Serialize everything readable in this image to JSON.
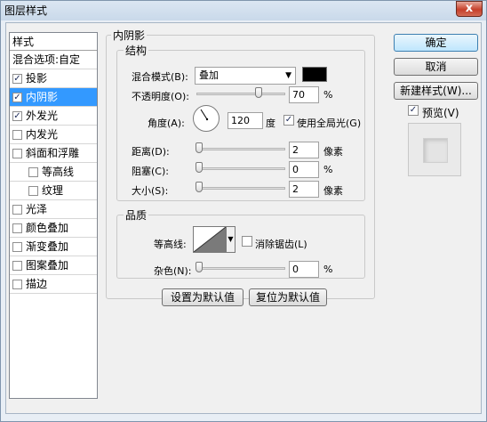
{
  "window": {
    "title": "图层样式",
    "close_label": "x"
  },
  "styles_list": {
    "header": "样式",
    "blend_options": "混合选项:自定",
    "items": [
      {
        "label": "投影",
        "checked": true,
        "indent": 0,
        "selected": false
      },
      {
        "label": "内阴影",
        "checked": true,
        "indent": 0,
        "selected": true
      },
      {
        "label": "外发光",
        "checked": true,
        "indent": 0,
        "selected": false
      },
      {
        "label": "内发光",
        "checked": false,
        "indent": 0,
        "selected": false
      },
      {
        "label": "斜面和浮雕",
        "checked": false,
        "indent": 0,
        "selected": false
      },
      {
        "label": "等高线",
        "checked": false,
        "indent": 1,
        "selected": false
      },
      {
        "label": "纹理",
        "checked": false,
        "indent": 1,
        "selected": false
      },
      {
        "label": "光泽",
        "checked": false,
        "indent": 0,
        "selected": false
      },
      {
        "label": "颜色叠加",
        "checked": false,
        "indent": 0,
        "selected": false
      },
      {
        "label": "渐变叠加",
        "checked": false,
        "indent": 0,
        "selected": false
      },
      {
        "label": "图案叠加",
        "checked": false,
        "indent": 0,
        "selected": false
      },
      {
        "label": "描边",
        "checked": false,
        "indent": 0,
        "selected": false
      }
    ]
  },
  "panel": {
    "title": "内阴影",
    "structure": {
      "legend": "结构",
      "blend_mode_label": "混合模式(B):",
      "blend_mode_value": "叠加",
      "shadow_color": "#000000",
      "opacity_label": "不透明度(O):",
      "opacity_value": "70",
      "opacity_unit": "%",
      "opacity_fraction": 0.7,
      "angle_label": "角度(A):",
      "angle_value": "120",
      "angle_unit": "度",
      "global_light_label": "使用全局光(G)",
      "global_light_checked": true,
      "distance_label": "距离(D):",
      "distance_value": "2",
      "distance_unit": "像素",
      "choke_label": "阻塞(C):",
      "choke_value": "0",
      "choke_unit": "%",
      "size_label": "大小(S):",
      "size_value": "2",
      "size_unit": "像素"
    },
    "quality": {
      "legend": "品质",
      "contour_label": "等高线:",
      "antialias_label": "消除锯齿(L)",
      "antialias_checked": false,
      "noise_label": "杂色(N):",
      "noise_value": "0",
      "noise_unit": "%"
    },
    "set_default_label": "设置为默认值",
    "reset_default_label": "复位为默认值"
  },
  "buttons": {
    "ok": "确定",
    "cancel": "取消",
    "new_style": "新建样式(W)...",
    "preview_label": "预览(V)",
    "preview_checked": true
  }
}
